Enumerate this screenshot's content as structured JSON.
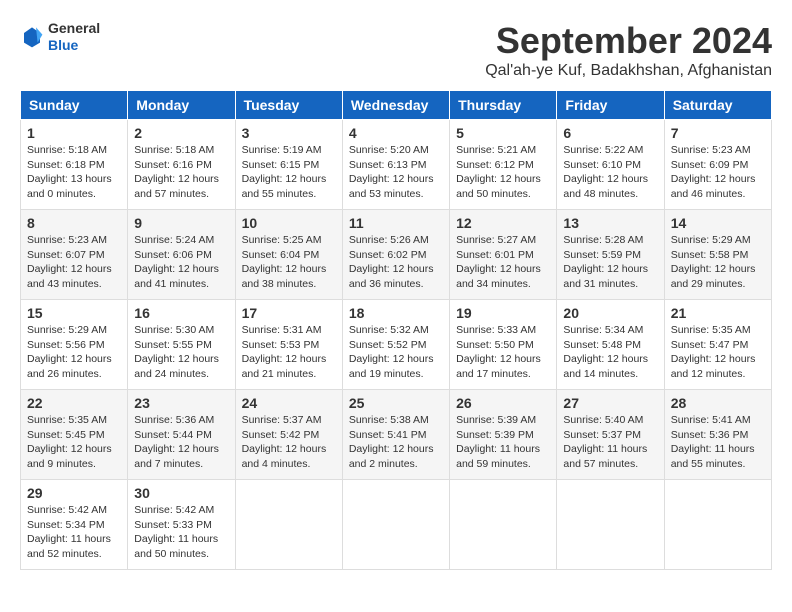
{
  "header": {
    "logo_line1": "General",
    "logo_line2": "Blue",
    "month": "September 2024",
    "location": "Qal'ah-ye Kuf, Badakhshan, Afghanistan"
  },
  "columns": [
    "Sunday",
    "Monday",
    "Tuesday",
    "Wednesday",
    "Thursday",
    "Friday",
    "Saturday"
  ],
  "weeks": [
    [
      {
        "day": "1",
        "info": "Sunrise: 5:18 AM\nSunset: 6:18 PM\nDaylight: 13 hours\nand 0 minutes."
      },
      {
        "day": "2",
        "info": "Sunrise: 5:18 AM\nSunset: 6:16 PM\nDaylight: 12 hours\nand 57 minutes."
      },
      {
        "day": "3",
        "info": "Sunrise: 5:19 AM\nSunset: 6:15 PM\nDaylight: 12 hours\nand 55 minutes."
      },
      {
        "day": "4",
        "info": "Sunrise: 5:20 AM\nSunset: 6:13 PM\nDaylight: 12 hours\nand 53 minutes."
      },
      {
        "day": "5",
        "info": "Sunrise: 5:21 AM\nSunset: 6:12 PM\nDaylight: 12 hours\nand 50 minutes."
      },
      {
        "day": "6",
        "info": "Sunrise: 5:22 AM\nSunset: 6:10 PM\nDaylight: 12 hours\nand 48 minutes."
      },
      {
        "day": "7",
        "info": "Sunrise: 5:23 AM\nSunset: 6:09 PM\nDaylight: 12 hours\nand 46 minutes."
      }
    ],
    [
      {
        "day": "8",
        "info": "Sunrise: 5:23 AM\nSunset: 6:07 PM\nDaylight: 12 hours\nand 43 minutes."
      },
      {
        "day": "9",
        "info": "Sunrise: 5:24 AM\nSunset: 6:06 PM\nDaylight: 12 hours\nand 41 minutes."
      },
      {
        "day": "10",
        "info": "Sunrise: 5:25 AM\nSunset: 6:04 PM\nDaylight: 12 hours\nand 38 minutes."
      },
      {
        "day": "11",
        "info": "Sunrise: 5:26 AM\nSunset: 6:02 PM\nDaylight: 12 hours\nand 36 minutes."
      },
      {
        "day": "12",
        "info": "Sunrise: 5:27 AM\nSunset: 6:01 PM\nDaylight: 12 hours\nand 34 minutes."
      },
      {
        "day": "13",
        "info": "Sunrise: 5:28 AM\nSunset: 5:59 PM\nDaylight: 12 hours\nand 31 minutes."
      },
      {
        "day": "14",
        "info": "Sunrise: 5:29 AM\nSunset: 5:58 PM\nDaylight: 12 hours\nand 29 minutes."
      }
    ],
    [
      {
        "day": "15",
        "info": "Sunrise: 5:29 AM\nSunset: 5:56 PM\nDaylight: 12 hours\nand 26 minutes."
      },
      {
        "day": "16",
        "info": "Sunrise: 5:30 AM\nSunset: 5:55 PM\nDaylight: 12 hours\nand 24 minutes."
      },
      {
        "day": "17",
        "info": "Sunrise: 5:31 AM\nSunset: 5:53 PM\nDaylight: 12 hours\nand 21 minutes."
      },
      {
        "day": "18",
        "info": "Sunrise: 5:32 AM\nSunset: 5:52 PM\nDaylight: 12 hours\nand 19 minutes."
      },
      {
        "day": "19",
        "info": "Sunrise: 5:33 AM\nSunset: 5:50 PM\nDaylight: 12 hours\nand 17 minutes."
      },
      {
        "day": "20",
        "info": "Sunrise: 5:34 AM\nSunset: 5:48 PM\nDaylight: 12 hours\nand 14 minutes."
      },
      {
        "day": "21",
        "info": "Sunrise: 5:35 AM\nSunset: 5:47 PM\nDaylight: 12 hours\nand 12 minutes."
      }
    ],
    [
      {
        "day": "22",
        "info": "Sunrise: 5:35 AM\nSunset: 5:45 PM\nDaylight: 12 hours\nand 9 minutes."
      },
      {
        "day": "23",
        "info": "Sunrise: 5:36 AM\nSunset: 5:44 PM\nDaylight: 12 hours\nand 7 minutes."
      },
      {
        "day": "24",
        "info": "Sunrise: 5:37 AM\nSunset: 5:42 PM\nDaylight: 12 hours\nand 4 minutes."
      },
      {
        "day": "25",
        "info": "Sunrise: 5:38 AM\nSunset: 5:41 PM\nDaylight: 12 hours\nand 2 minutes."
      },
      {
        "day": "26",
        "info": "Sunrise: 5:39 AM\nSunset: 5:39 PM\nDaylight: 11 hours\nand 59 minutes."
      },
      {
        "day": "27",
        "info": "Sunrise: 5:40 AM\nSunset: 5:37 PM\nDaylight: 11 hours\nand 57 minutes."
      },
      {
        "day": "28",
        "info": "Sunrise: 5:41 AM\nSunset: 5:36 PM\nDaylight: 11 hours\nand 55 minutes."
      }
    ],
    [
      {
        "day": "29",
        "info": "Sunrise: 5:42 AM\nSunset: 5:34 PM\nDaylight: 11 hours\nand 52 minutes."
      },
      {
        "day": "30",
        "info": "Sunrise: 5:42 AM\nSunset: 5:33 PM\nDaylight: 11 hours\nand 50 minutes."
      },
      {
        "day": "",
        "info": ""
      },
      {
        "day": "",
        "info": ""
      },
      {
        "day": "",
        "info": ""
      },
      {
        "day": "",
        "info": ""
      },
      {
        "day": "",
        "info": ""
      }
    ]
  ]
}
